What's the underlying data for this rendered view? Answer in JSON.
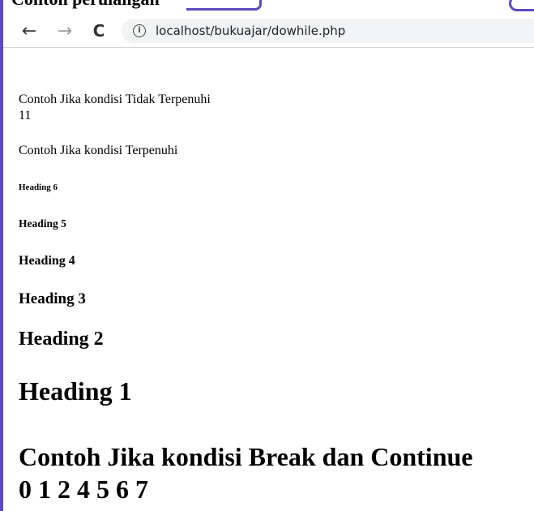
{
  "page_header": {
    "cut_title": "Contoh perulangan"
  },
  "browser": {
    "url": "localhost/bukuajar/dowhile.php",
    "back_glyph": "←",
    "forward_glyph": "→",
    "reload_glyph": "C",
    "info_glyph": "i",
    "icons": {
      "back": "arrow-left-icon",
      "forward": "arrow-right-icon",
      "reload": "reload-icon",
      "info": "info-icon"
    },
    "accent_color": "#5b4bbf"
  },
  "page": {
    "line1": "Contoh Jika kondisi Tidak Terpenuhi",
    "line1_value": "11",
    "line2": "Contoh Jika kondisi Terpenuhi",
    "heading6": "Heading 6",
    "heading5": "Heading 5",
    "heading4": "Heading 4",
    "heading3": "Heading 3",
    "heading2": "Heading 2",
    "heading1": "Heading 1",
    "break_continue_title": "Contoh Jika kondisi Break dan Continue",
    "break_continue_output": "0 1 2 4 5 6 7"
  }
}
